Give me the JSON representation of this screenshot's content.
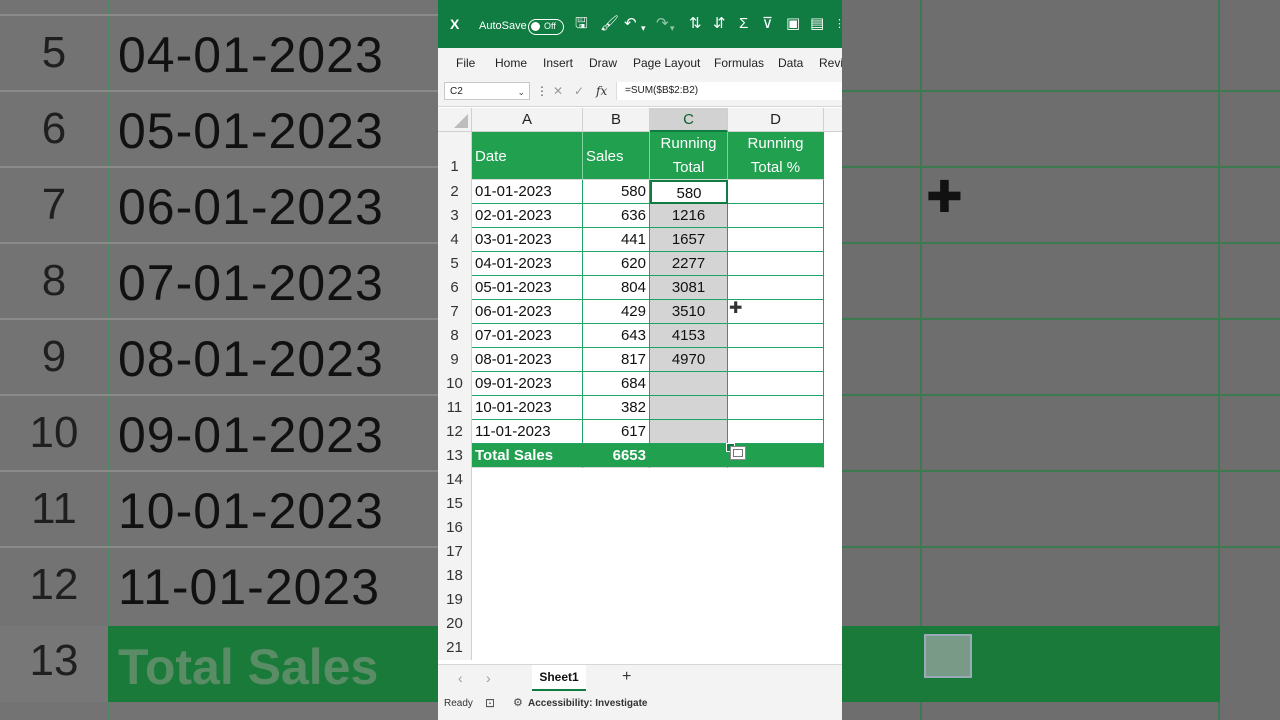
{
  "app": {
    "autosave_label": "AutoSave",
    "autosave_state": "Off",
    "accent_color": "#107c41",
    "header_fill_color": "#21a050"
  },
  "ribbon": {
    "tabs": [
      "File",
      "Home",
      "Insert",
      "Draw",
      "Page Layout",
      "Formulas",
      "Data",
      "Revi"
    ]
  },
  "formula_bar": {
    "name_box": "C2",
    "formula": "=SUM($B$2:B2)"
  },
  "columns": [
    "A",
    "B",
    "C",
    "D"
  ],
  "header_row": {
    "row_number": "1",
    "a": "Date",
    "b": "Sales",
    "c_line1": "Running",
    "c_line2": "Total",
    "d_line1": "Running",
    "d_line2": "Total %"
  },
  "rows": [
    {
      "n": "2",
      "date": "01-01-2023",
      "sales": "580",
      "running": "580"
    },
    {
      "n": "3",
      "date": "02-01-2023",
      "sales": "636",
      "running": "1216"
    },
    {
      "n": "4",
      "date": "03-01-2023",
      "sales": "441",
      "running": "1657"
    },
    {
      "n": "5",
      "date": "04-01-2023",
      "sales": "620",
      "running": "2277"
    },
    {
      "n": "6",
      "date": "05-01-2023",
      "sales": "804",
      "running": "3081"
    },
    {
      "n": "7",
      "date": "06-01-2023",
      "sales": "429",
      "running": "3510"
    },
    {
      "n": "8",
      "date": "07-01-2023",
      "sales": "643",
      "running": "4153"
    },
    {
      "n": "9",
      "date": "08-01-2023",
      "sales": "817",
      "running": "4970"
    },
    {
      "n": "10",
      "date": "09-01-2023",
      "sales": "684",
      "running": ""
    },
    {
      "n": "11",
      "date": "10-01-2023",
      "sales": "382",
      "running": ""
    },
    {
      "n": "12",
      "date": "11-01-2023",
      "sales": "617",
      "running": ""
    }
  ],
  "total_row": {
    "n": "13",
    "label": "Total Sales",
    "value": "6653"
  },
  "empty_rows": [
    "14",
    "15",
    "16",
    "17",
    "18",
    "19",
    "20",
    "21"
  ],
  "sheet_tabs": {
    "active": "Sheet1",
    "add": "+",
    "prev": "‹",
    "next": "›"
  },
  "status_bar": {
    "ready": "Ready",
    "accessibility": "Accessibility: Investigate"
  },
  "background_zoom": {
    "rows": [
      {
        "n": "5",
        "date": "04-01-2023"
      },
      {
        "n": "6",
        "date": "05-01-2023"
      },
      {
        "n": "7",
        "date": "06-01-2023"
      },
      {
        "n": "8",
        "date": "07-01-2023"
      },
      {
        "n": "9",
        "date": "08-01-2023"
      },
      {
        "n": "10",
        "date": "09-01-2023"
      },
      {
        "n": "11",
        "date": "10-01-2023"
      },
      {
        "n": "12",
        "date": "11-01-2023"
      }
    ],
    "total_n": "13",
    "total_label": "Total Sales"
  }
}
